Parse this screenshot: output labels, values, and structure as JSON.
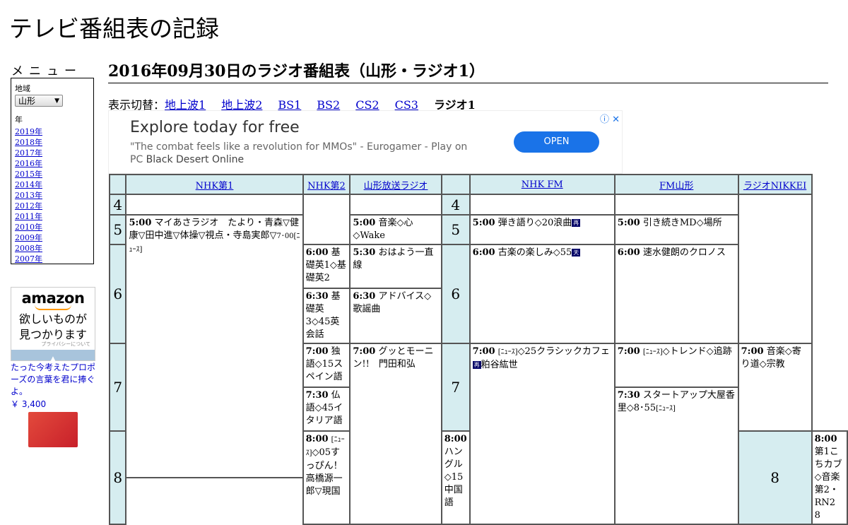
{
  "site_title": "テレビ番組表の記録",
  "sidebar": {
    "menu_title": "メニュー",
    "region_label": "地域",
    "region_value": "山形",
    "year_label": "年",
    "years": [
      "2019年",
      "2018年",
      "2017年",
      "2016年",
      "2015年",
      "2014年",
      "2013年",
      "2012年",
      "2011年",
      "2010年",
      "2009年",
      "2008年",
      "2007年"
    ],
    "amazon": {
      "logo": "amazon",
      "message_line1": "欲しいものが",
      "message_line2": "見つかります",
      "privacy": "プライバシーについて",
      "product_title": "たった今考えたプロポーズの言葉を君に捧ぐよ。",
      "product_price": "￥ 3,400"
    }
  },
  "main": {
    "heading": "2016年09月30日のラジオ番組表（山形・ラジオ1）",
    "switch_label": "表示切替：",
    "switch_links": [
      "地上波1",
      "地上波2",
      "BS1",
      "BS2",
      "CS2",
      "CS3"
    ],
    "switch_current": "ラジオ1"
  },
  "ad": {
    "headline": "Explore today for free",
    "desc_quote": "\"The combat feels like a revolution for MMOs\" - Eurogamer - Play on PC",
    "desc_brand": "Black Desert Online",
    "button": "OPEN",
    "icons": "ⓘ ✕"
  },
  "schedule": {
    "channels": [
      "NHK第1",
      "NHK第2",
      "山形放送ラジオ",
      "NHK FM",
      "FM山形",
      "ラジオNIKKEI"
    ],
    "hours": [
      "4",
      "5",
      "6",
      "7",
      "8"
    ],
    "hours_right": [
      "4",
      "5",
      "6",
      "7",
      "8"
    ],
    "programs": {
      "nhk1_500_time": "5:00",
      "nhk1_500_title": "マイあさラジオ　たより・青森▽健康▽田中進▽体操▽視点・寺島実郎▽",
      "nhk1_500_small": "7･00[ﾆｭｰｽ]",
      "nhk1_800_time": "8:00",
      "nhk1_800_title": "◇05すっぴん！　高橋源一郎▽現国",
      "nhk1_800_small": "[ﾆｭｰｽ]",
      "nhk2_600_time": "6:00",
      "nhk2_600_title": "基礎英1◇基礎英2",
      "nhk2_630_time": "6:30",
      "nhk2_630_title": "基礎英3◇45英会話",
      "nhk2_700_time": "7:00",
      "nhk2_700_title": "独語◇15スペイン語",
      "nhk2_730_time": "7:30",
      "nhk2_730_title": "仏語◇45イタリア語",
      "nhk2_800_time": "8:00",
      "nhk2_800_title": "ハングル◇15中国語",
      "ybc_500_time": "5:00",
      "ybc_500_title": "音楽◇心◇Wake",
      "ybc_530_time": "5:30",
      "ybc_530_title": "おはよう一直線",
      "ybc_630_time": "6:30",
      "ybc_630_title": "アドバイス◇歌謡曲",
      "ybc_700_time": "7:00",
      "ybc_700_title": "グッとモーニン!!　門田和弘",
      "fm_500_time": "5:00",
      "fm_500_title": "弾き語り◇20浪曲",
      "fm_500_badge": "再",
      "fm_600_time": "6:00",
      "fm_600_title": "古楽の楽しみ◇55",
      "fm_600_badge": "天",
      "fm_700_time": "7:00",
      "fm_700_small": "[ﾆｭｰｽ]",
      "fm_700_title": "◇25クラシックカフェ",
      "fm_700_badge": "再",
      "fm_700_title2": "粕谷紘世",
      "fmy_500_time": "5:00",
      "fmy_500_title": "引き続きMD◇場所",
      "fmy_600_time": "6:00",
      "fmy_600_title": "速水健朗のクロノス",
      "fmy_700_time": "7:00",
      "fmy_700_small": "[ﾆｭｰｽ]",
      "fmy_700_title": "◇トレンド◇追跡",
      "fmy_730_time": "7:30",
      "fmy_730_title": "スタートアップ大屋香里◇8･55",
      "fmy_730_small": "[ﾆｭｰｽ]",
      "nikkei_700_time": "7:00",
      "nikkei_700_title": "音楽◇寄り道◇宗教",
      "nikkei_800_time": "8:00",
      "nikkei_800_title": "第1こちカブ◇音楽第2・RN2　8"
    }
  }
}
